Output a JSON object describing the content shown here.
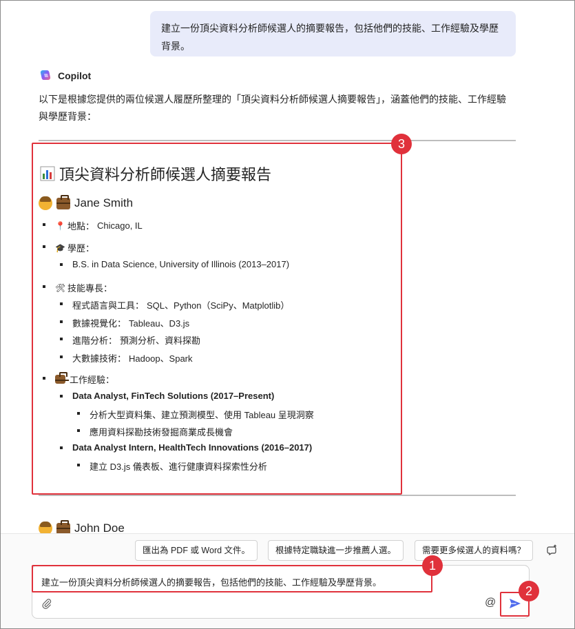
{
  "user_message": "建立一份頂尖資料分析師候選人的摘要報告，包括他們的技能、工作經驗及學歷背景。",
  "copilot": {
    "name": "Copilot",
    "intro": "以下是根據您提供的兩位候選人履歷所整理的「頂尖資料分析師候選人摘要報告」，涵蓋他們的技能、工作經驗與學歷背景："
  },
  "report": {
    "title": "頂尖資料分析師候選人摘要報告",
    "candidate1": {
      "name": "Jane Smith",
      "location_label": "地點：",
      "location": "Chicago, IL",
      "education_label": "學歷：",
      "education": "B.S. in Data Science, University of Illinois (2013–2017)",
      "skills_label": "技能專長：",
      "skills": [
        {
          "label": "程式語言與工具：",
          "value": "SQL、Python（SciPy、Matplotlib）"
        },
        {
          "label": "數據視覺化：",
          "value": "Tableau、D3.js"
        },
        {
          "label": "進階分析：",
          "value": "預測分析、資料探勘"
        },
        {
          "label": "大數據技術：",
          "value": "Hadoop、Spark"
        }
      ],
      "experience_label": "工作經驗：",
      "experience": [
        {
          "title": "Data Analyst, FinTech Solutions (2017–Present)",
          "items": [
            "分析大型資料集、建立預測模型、使用 Tableau 呈現洞察",
            "應用資料探勘技術發掘商業成長機會"
          ]
        },
        {
          "title": "Data Analyst Intern, HealthTech Innovations (2016–2017)",
          "items": [
            "建立 D3.js 儀表板、進行健康資料探索性分析"
          ]
        }
      ]
    },
    "candidate2": {
      "name": "John Doe"
    }
  },
  "suggestions": [
    "匯出為 PDF 或 Word 文件。",
    "根據特定職缺進一步推薦人選。",
    "需要更多候選人的資料嗎？"
  ],
  "composer": {
    "text": "建立一份頂尖資料分析師候選人的摘要報告，包括他們的技能、工作經驗及學歷背景。",
    "at_symbol": "@"
  },
  "annotations": [
    "1",
    "2",
    "3"
  ],
  "colors": {
    "accent": "#4f6bed",
    "highlight": "#e0313b",
    "user_bubble": "#e8ebfa"
  }
}
